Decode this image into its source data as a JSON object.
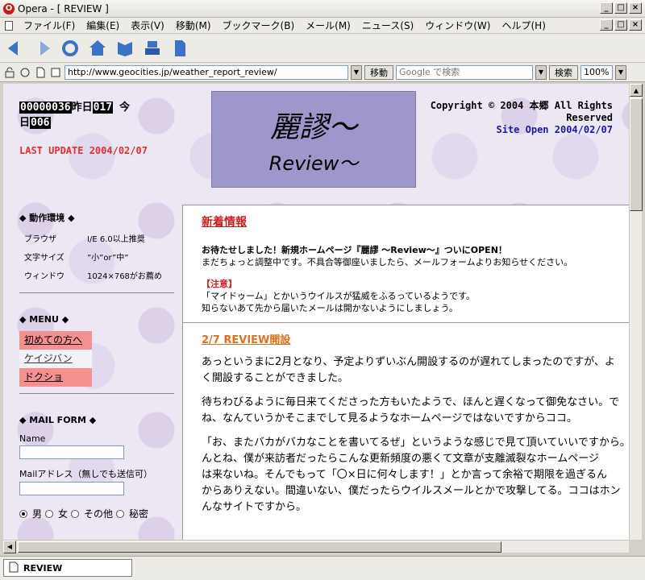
{
  "window": {
    "title": "Opera - [ REVIEW ]",
    "app_icon_letter": "O",
    "min": "_",
    "max": "□",
    "close": "×"
  },
  "menu": {
    "items": [
      "ファイル(F)",
      "編集(E)",
      "表示(V)",
      "移動(M)",
      "ブックマーク(B)",
      "メール(M)",
      "ニュース(S)",
      "ウィンドウ(W)",
      "ヘルプ(H)"
    ]
  },
  "address": {
    "url": "http://www.geocities.jp/weather_report_review/",
    "go_label": "移動",
    "search_placeholder": "Google で検索",
    "search_label": "検索",
    "zoom": "100%"
  },
  "header": {
    "counter_total": "00000036",
    "yesterday_label": "昨日",
    "yesterday_value": "017",
    "today_label_a": "今",
    "today_label_b": "日",
    "today_value": "006",
    "last_update": "LAST UPDATE 2004/02/07",
    "logo_main": "麗謬～",
    "logo_sub": "Review～",
    "copyright": "Copyright © 2004 本郷 All Rights Reserved",
    "site_open": "Site Open 2004/02/07"
  },
  "sidebar": {
    "env_title": "◆ 動作環境 ◆",
    "env": [
      {
        "k": "ブラウザ",
        "v": "I/E 6.0以上推奨"
      },
      {
        "k": "文字サイズ",
        "v": "”小”or”中”"
      },
      {
        "k": "ウィンドウ",
        "v": "1024×768がお薦め"
      }
    ],
    "menu_title": "◆ MENU ◆",
    "menu": [
      "初めての方へ",
      "ケイジバン",
      "ドクショ"
    ],
    "mail_title": "◆ MAIL FORM ◆",
    "name_label": "Name",
    "mail_label": "Mailアドレス（無しでも送信可）",
    "gender": [
      "男",
      "女",
      "その他",
      "秘密"
    ]
  },
  "news": {
    "title": "新着情報",
    "headline": "お待たせしました！新規ホームページ『麗謬 ～Review～』ついにOPEN！",
    "line2": "まだちょっと調整中です。不具合等御座いましたら、メールフォームよりお知らせください。",
    "caution_title": "【注意】",
    "caution1": "「マイドゥーム」とかいうウイルスが猛威をふるっているようです。",
    "caution2": "知らないあて先から届いたメールは開かないようにしましょう。"
  },
  "blog": {
    "title": "2/7 REVIEW開設",
    "p1a": "あっというまに2月となり、予定よりずいぶん開設するのが遅れてしまったのですが、よ",
    "p1b": "く開設することができました。",
    "p2a": "待ちわびるように毎日来てくださった方もいたようで、ほんと遅くなって御免なさい。で",
    "p2b": "ね、なんていうかそこまでして見るようなホームページではないですからココ。",
    "p3a": "「お、またバカがバカなことを書いてるぜ」というような感じで見て頂いていいですから。",
    "p3b": "んとね、僕が来訪者だったらこんな更新頻度の悪くて文章が支離滅裂なホームページ",
    "p3c": "は来ないね。そんでもって「〇×日に何々します！」とか言って余裕で期限を過ぎるん",
    "p3d": "からありえない。間違いない、僕だったらウイルスメールとかで攻撃してる。ココはホン",
    "p3e": "んなサイトですから。"
  },
  "status": {
    "tab_label": "REVIEW"
  }
}
